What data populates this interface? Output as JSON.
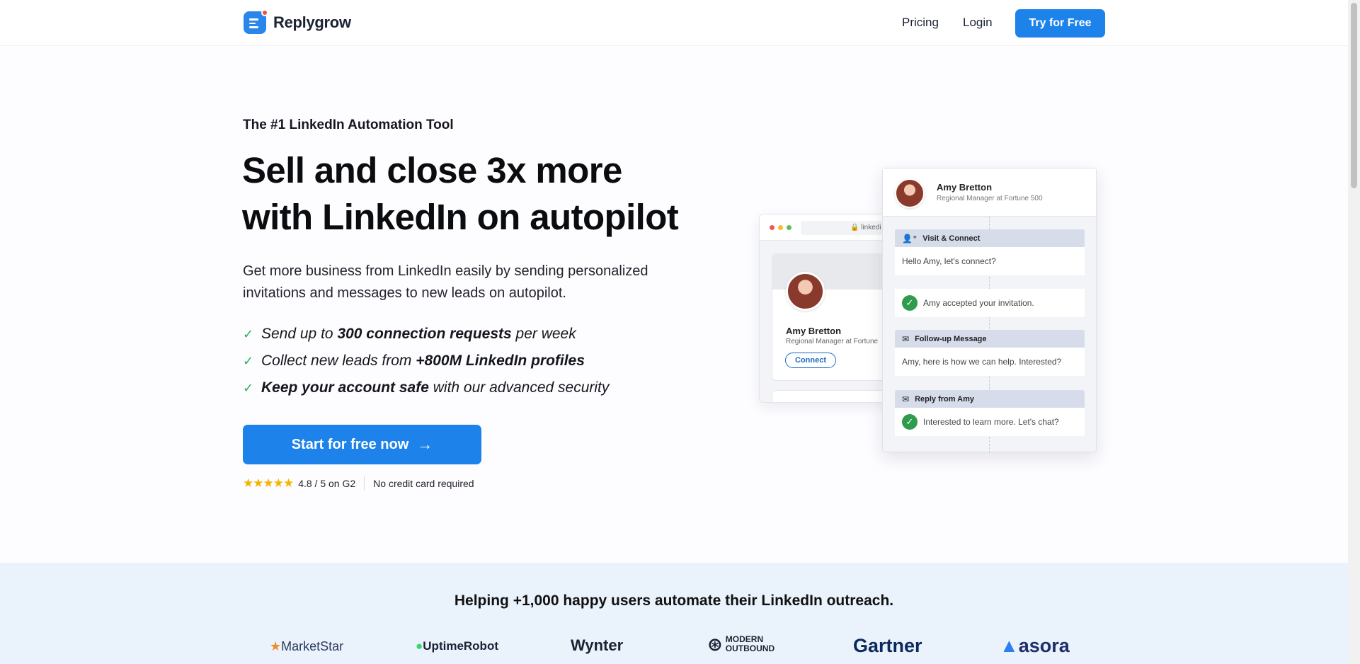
{
  "header": {
    "brand": "Replygrow",
    "nav": {
      "pricing": "Pricing",
      "login": "Login",
      "cta": "Try for Free"
    }
  },
  "hero": {
    "eyebrow": "The #1 LinkedIn Automation Tool",
    "headline_line1": "Sell and close 3x more",
    "headline_line2": "with LinkedIn on autopilot",
    "subtext": "Get more business from LinkedIn easily by sending personalized invitations and messages to new leads on autopilot.",
    "features": [
      {
        "pre": "Send up to ",
        "bold": "300 connection requests",
        "post": " per week"
      },
      {
        "pre": "Collect new leads from ",
        "bold": "+800M LinkedIn profiles",
        "post": ""
      },
      {
        "pre": "",
        "bold": "Keep your account safe",
        "post": " with our advanced security"
      }
    ],
    "cta": "Start for free now",
    "rating": "4.8 / 5 on G2",
    "stars": "★★★★★",
    "no_card": "No credit card required"
  },
  "illustration": {
    "url": "linkedi",
    "profile": {
      "name": "Amy Bretton",
      "role": "Regional Manager at Fortune",
      "connect": "Connect"
    },
    "panel": {
      "name": "Amy Bretton",
      "role": "Regional Manager at Fortune 500",
      "steps": [
        {
          "title": "Visit & Connect",
          "text": "Hello Amy, let's connect?"
        },
        {
          "title": "",
          "text": "Amy accepted your invitation."
        },
        {
          "title": "Follow-up Message",
          "text": "Amy, here is how we can help. Interested?"
        },
        {
          "title": "Reply from Amy",
          "text": "Interested to learn more. Let's chat?"
        }
      ]
    }
  },
  "social_proof": {
    "title": "Helping +1,000 happy users automate their LinkedIn outreach.",
    "logos": [
      "MarketStar",
      "UptimeRobot",
      "Wynter",
      "MODERN OUTBOUND",
      "Gartner",
      "asora"
    ]
  },
  "colors": {
    "primary": "#1d83ea",
    "check": "#27ae60",
    "star": "#f5b400",
    "proof_bg": "#eaf2fc"
  },
  "icons": [
    "logo-mark",
    "check-icon",
    "arrow-right-icon",
    "star-icon",
    "person-add-icon",
    "mail-icon",
    "check-circle-icon"
  ]
}
